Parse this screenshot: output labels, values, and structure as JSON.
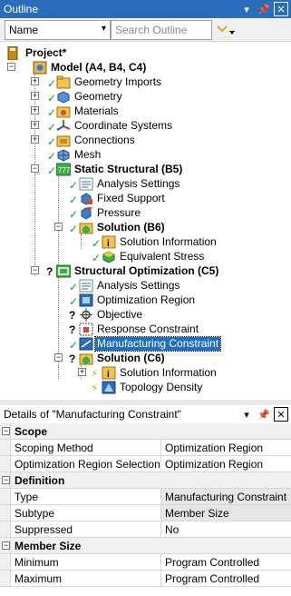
{
  "outline": {
    "title": "Outline",
    "name_filter": "Name",
    "search_placeholder": "Search Outline",
    "project": "Project*",
    "model": "Model (A4, B4, C4)",
    "geometry_imports": "Geometry Imports",
    "geometry": "Geometry",
    "materials": "Materials",
    "coordinate_systems": "Coordinate Systems",
    "connections": "Connections",
    "mesh": "Mesh",
    "static_structural": "Static Structural (B5)",
    "analysis_settings_1": "Analysis Settings",
    "fixed_support": "Fixed Support",
    "pressure": "Pressure",
    "solution_b6": "Solution (B6)",
    "solution_information_1": "Solution Information",
    "equivalent_stress": "Equivalent Stress",
    "structural_optimization": "Structural Optimization (C5)",
    "analysis_settings_2": "Analysis Settings",
    "optimization_region": "Optimization Region",
    "objective": "Objective",
    "response_constraint": "Response Constraint",
    "manufacturing_constraint": "Manufacturing Constraint",
    "solution_c6": "Solution (C6)",
    "solution_information_2": "Solution Information",
    "topology_density": "Topology Density"
  },
  "details": {
    "title": "Details of \"Manufacturing Constraint\"",
    "groups": [
      {
        "name": "Scope",
        "rows": [
          {
            "key": "Scoping Method",
            "value": "Optimization Region"
          },
          {
            "key": "Optimization Region Selection",
            "value": "Optimization Region"
          }
        ]
      },
      {
        "name": "Definition",
        "rows": [
          {
            "key": "Type",
            "value": "Manufacturing Constraint"
          },
          {
            "key": "Subtype",
            "value": "Member Size"
          },
          {
            "key": "Suppressed",
            "value": "No"
          }
        ]
      },
      {
        "name": "Member Size",
        "rows": [
          {
            "key": "Minimum",
            "value": "Program Controlled"
          },
          {
            "key": "Maximum",
            "value": "Program Controlled"
          }
        ]
      }
    ]
  },
  "colors": {
    "titlebar": "#2a6ebb",
    "selection": "#1e6fc4",
    "check": "#1a9c2a",
    "qmark": "#000000"
  },
  "icons": {
    "pin": "pin-icon",
    "close": "close-icon",
    "dropdown": "chevron-down-icon"
  }
}
